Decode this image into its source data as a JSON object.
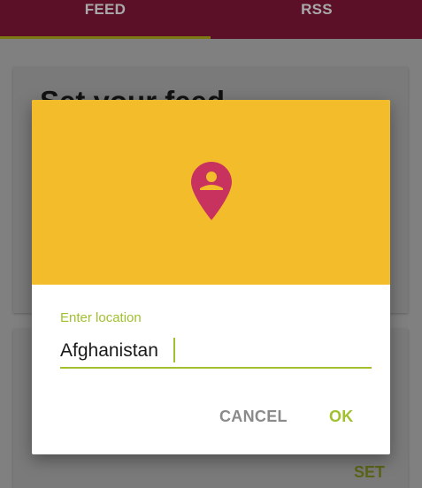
{
  "tabs": {
    "feed_label": "FEED",
    "rss_label": "RSS"
  },
  "background": {
    "card_title": "Set your feed",
    "set_label": "SET"
  },
  "dialog": {
    "header_icon": "location-pin-person-icon",
    "field_label": "Enter location",
    "field_value": "Afghanistan",
    "cancel_label": "CANCEL",
    "ok_label": "OK"
  },
  "colors": {
    "header": "#f2bc2a",
    "pin": "#c8325e",
    "accent": "#a1c030",
    "tabbar": "#5b1027"
  }
}
